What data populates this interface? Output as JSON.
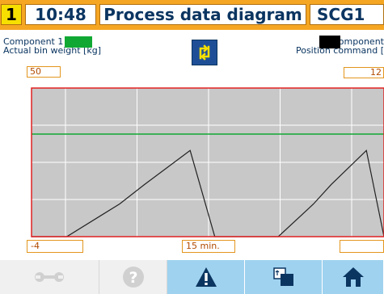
{
  "header": {
    "screen_number": "1",
    "time": "10:48",
    "title": "Process data diagram",
    "device": "SCG1"
  },
  "left_panel": {
    "component": "Component 1",
    "variable": "Actual bin weight [kg]",
    "value": "50"
  },
  "right_panel": {
    "component": "Component",
    "variable": "Position command [",
    "value": "12"
  },
  "scale": {
    "min_left": "-4",
    "time_span": "15 min.",
    "min_right": ""
  },
  "colors": {
    "header": "#f5a623",
    "chart_bg": "#c8c8c8",
    "chart_border": "#e02020",
    "limit_line": "#10a833",
    "trace": "#222222",
    "accent_blue": "#1e4f96",
    "bottom_bar": "#bfe3f7"
  },
  "toolbar": {
    "buttons": [
      "wrench-icon",
      "help-icon",
      "warning-icon",
      "window-switch-icon",
      "home-icon"
    ]
  },
  "chart_data": {
    "type": "line",
    "title": "",
    "xlabel": "",
    "ylabel": "",
    "x": [
      0,
      10,
      25,
      32,
      45,
      52,
      55,
      70,
      80,
      85,
      95,
      100
    ],
    "series": [
      {
        "values": [
          0,
          0,
          22,
          35,
          58,
          0,
          0,
          0,
          22,
          35,
          58,
          0
        ]
      }
    ],
    "ylim": [
      0,
      100
    ],
    "xlim": [
      0,
      100
    ],
    "limit": 69,
    "grid": true
  }
}
